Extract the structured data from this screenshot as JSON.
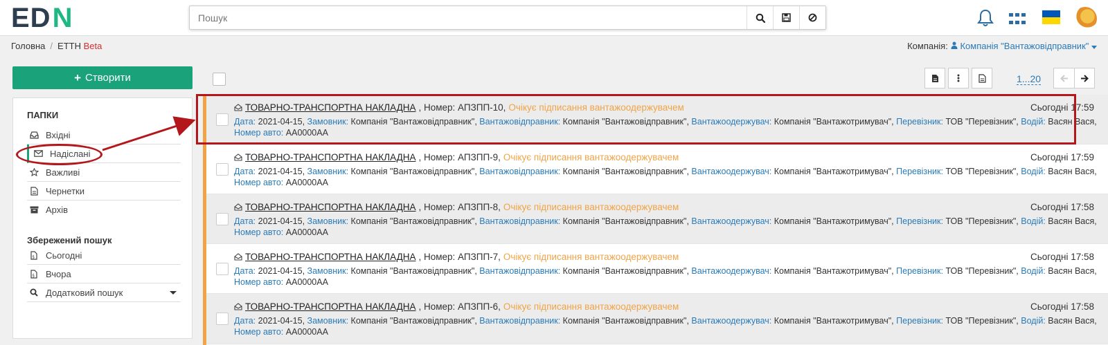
{
  "header": {
    "logo_ed": "ED",
    "logo_n": "N",
    "search_placeholder": "Пошук"
  },
  "breadcrumb": {
    "home": "Головна",
    "current": "ЕТТН",
    "current_badge": "Beta"
  },
  "company": {
    "label": "Компанія:",
    "value": "Компанія \"Вантажовідправник\""
  },
  "sidebar": {
    "create_label": "Створити",
    "folders_title": "ПАПКИ",
    "folders": [
      {
        "label": "Вхідні",
        "icon": "inbox-icon"
      },
      {
        "label": "Надіслані",
        "icon": "envelope-icon"
      },
      {
        "label": "Важливі",
        "icon": "star-icon"
      },
      {
        "label": "Чернетки",
        "icon": "draft-icon"
      },
      {
        "label": "Архів",
        "icon": "archive-icon"
      }
    ],
    "saved_title": "Збережений пошук",
    "saved": [
      {
        "label": "Сьогодні",
        "icon": "calendar-icon"
      },
      {
        "label": "Вчора",
        "icon": "calendar-icon"
      },
      {
        "label": "Додатковий пошук",
        "icon": "search-icon"
      }
    ]
  },
  "toolbar": {
    "pager": "1...20"
  },
  "documents": [
    {
      "title": "ТОВАРНО-ТРАНСПОРТНА НАКЛАДНА",
      "number": ", Номер: АПЗПП-10,",
      "status": "Очікує підписання вантажоодержувачем",
      "time": "Сьогодні 17:59",
      "date": "2021-04-15,",
      "customer": "Компанія \"Вантажовідправник\",",
      "shipper": "Компанія \"Вантажовідправник\",",
      "consignee": "Компанія \"Вантажотримувач\",",
      "carrier": "ТОВ \"Перевізник\",",
      "driver": "Васян Вася,",
      "car": "AA0000AA"
    },
    {
      "title": "ТОВАРНО-ТРАНСПОРТНА НАКЛАДНА",
      "number": ", Номер: АПЗПП-9,",
      "status": "Очікує підписання вантажоодержувачем",
      "time": "Сьогодні 17:59",
      "date": "2021-04-15,",
      "customer": "Компанія \"Вантажовідправник\",",
      "shipper": "Компанія \"Вантажовідправник\",",
      "consignee": "Компанія \"Вантажотримувач\",",
      "carrier": "ТОВ \"Перевізник\",",
      "driver": "Васян Вася,",
      "car": "AA0000AA"
    },
    {
      "title": "ТОВАРНО-ТРАНСПОРТНА НАКЛАДНА",
      "number": ", Номер: АПЗПП-8,",
      "status": "Очікує підписання вантажоодержувачем",
      "time": "Сьогодні 17:58",
      "date": "2021-04-15,",
      "customer": "Компанія \"Вантажовідправник\",",
      "shipper": "Компанія \"Вантажовідправник\",",
      "consignee": "Компанія \"Вантажотримувач\",",
      "carrier": "ТОВ \"Перевізник\",",
      "driver": "Васян Вася,",
      "car": "AA0000AA"
    },
    {
      "title": "ТОВАРНО-ТРАНСПОРТНА НАКЛАДНА",
      "number": ", Номер: АПЗПП-7,",
      "status": "Очікує підписання вантажоодержувачем",
      "time": "Сьогодні 17:58",
      "date": "2021-04-15,",
      "customer": "Компанія \"Вантажовідправник\",",
      "shipper": "Компанія \"Вантажовідправник\",",
      "consignee": "Компанія \"Вантажотримувач\",",
      "carrier": "ТОВ \"Перевізник\",",
      "driver": "Васян Вася,",
      "car": "AA0000AA"
    },
    {
      "title": "ТОВАРНО-ТРАНСПОРТНА НАКЛАДНА",
      "number": ", Номер: АПЗПП-6,",
      "status": "Очікує підписання вантажоодержувачем",
      "time": "Сьогодні 17:58",
      "date": "2021-04-15,",
      "customer": "Компанія \"Вантажовідправник\",",
      "shipper": "Компанія \"Вантажовідправник\",",
      "consignee": "Компанія \"Вантажотримувач\",",
      "carrier": "ТОВ \"Перевізник\",",
      "driver": "Васян Вася,",
      "car": "AA0000AA"
    }
  ],
  "field_labels": {
    "date": "Дата:",
    "customer": "Замовник:",
    "shipper": "Вантажовідправник:",
    "consignee": "Вантажоодержувач:",
    "carrier": "Перевізник:",
    "driver": "Водій:",
    "car": "Номер авто:"
  },
  "colors": {
    "accent_green": "#1aa37a",
    "status_orange": "#f0a447",
    "link_blue": "#2a7ab8",
    "annotation_red": "#b3161b"
  }
}
